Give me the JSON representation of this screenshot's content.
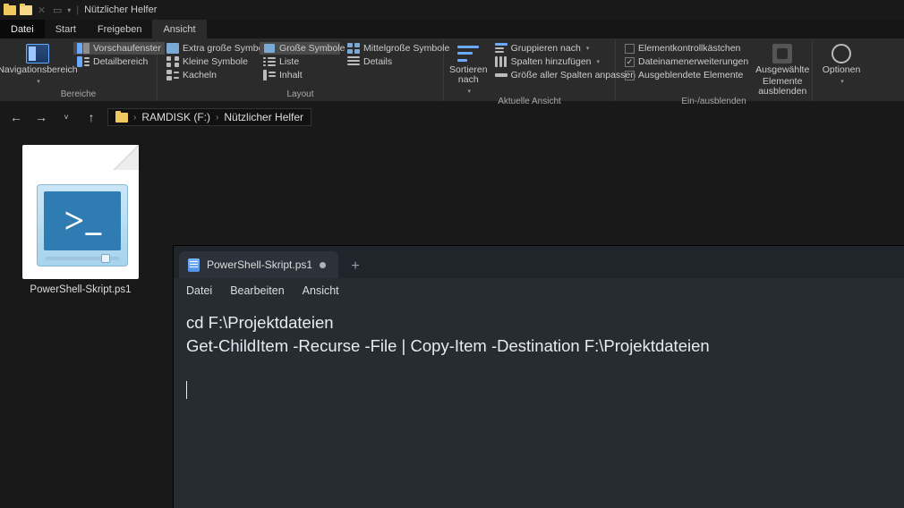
{
  "window": {
    "title": "Nützlicher Helfer"
  },
  "tabs": {
    "datei": "Datei",
    "start": "Start",
    "freigeben": "Freigeben",
    "ansicht": "Ansicht"
  },
  "ribbon": {
    "bereiche": {
      "label": "Bereiche",
      "navpane": "Navigationsbereich",
      "preview": "Vorschaufenster",
      "details": "Detailbereich"
    },
    "layout": {
      "label": "Layout",
      "xl": "Extra große Symbole",
      "lg": "Große Symbole",
      "md": "Mittelgroße Symbole",
      "sm": "Kleine Symbole",
      "list": "Liste",
      "det": "Details",
      "tile": "Kacheln",
      "content": "Inhalt"
    },
    "view": {
      "label": "Aktuelle Ansicht",
      "sort": "Sortieren nach",
      "group": "Gruppieren nach",
      "addcol": "Spalten hinzufügen",
      "fitcol": "Größe aller Spalten anpassen"
    },
    "showhide": {
      "label": "Ein-/ausblenden",
      "itemcb": "Elementkontrollkästchen",
      "ext": "Dateinamenerweiterungen",
      "hidden": "Ausgeblendete Elemente",
      "hidebtn_l1": "Ausgewählte",
      "hidebtn_l2": "Elemente ausblenden"
    },
    "options": {
      "label": "Optionen"
    }
  },
  "breadcrumb": {
    "root": "RAMDISK (F:)",
    "cur": "Nützlicher Helfer"
  },
  "file": {
    "name": "PowerShell-Skript.ps1",
    "ps_glyph": ">"
  },
  "editor": {
    "tab_title": "PowerShell-Skript.ps1",
    "menu": {
      "datei": "Datei",
      "bearbeiten": "Bearbeiten",
      "ansicht": "Ansicht"
    },
    "line1": "cd F:\\Projektdateien",
    "line2": "Get-ChildItem -Recurse -File | Copy-Item -Destination F:\\Projektdateien"
  }
}
